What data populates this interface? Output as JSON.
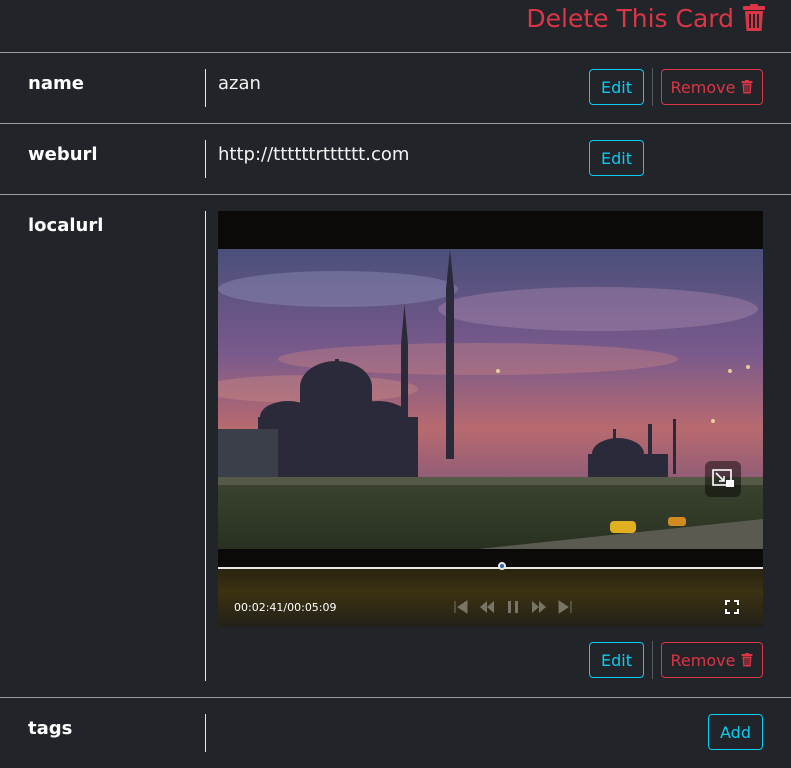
{
  "header": {
    "delete_label": "Delete This Card"
  },
  "fields": [
    {
      "key": "name",
      "value": "azan",
      "edit_label": "Edit",
      "remove_label": "Remove"
    },
    {
      "key": "weburl",
      "value": "http://ttttttrtttttt.com",
      "edit_label": "Edit"
    },
    {
      "key": "localurl",
      "edit_label": "Edit",
      "remove_label": "Remove",
      "video": {
        "current_time": "00:02:41",
        "duration": "00:05:09",
        "time_display": "00:02:41/00:05:09",
        "progress": 0.521
      }
    },
    {
      "key": "tags",
      "add_label": "Add"
    }
  ],
  "colors": {
    "danger": "#dc3545",
    "info": "#0dcaf0",
    "background": "#212429"
  },
  "icons": [
    "trash-icon",
    "fullscreen-icon",
    "picture-in-picture-icon"
  ]
}
